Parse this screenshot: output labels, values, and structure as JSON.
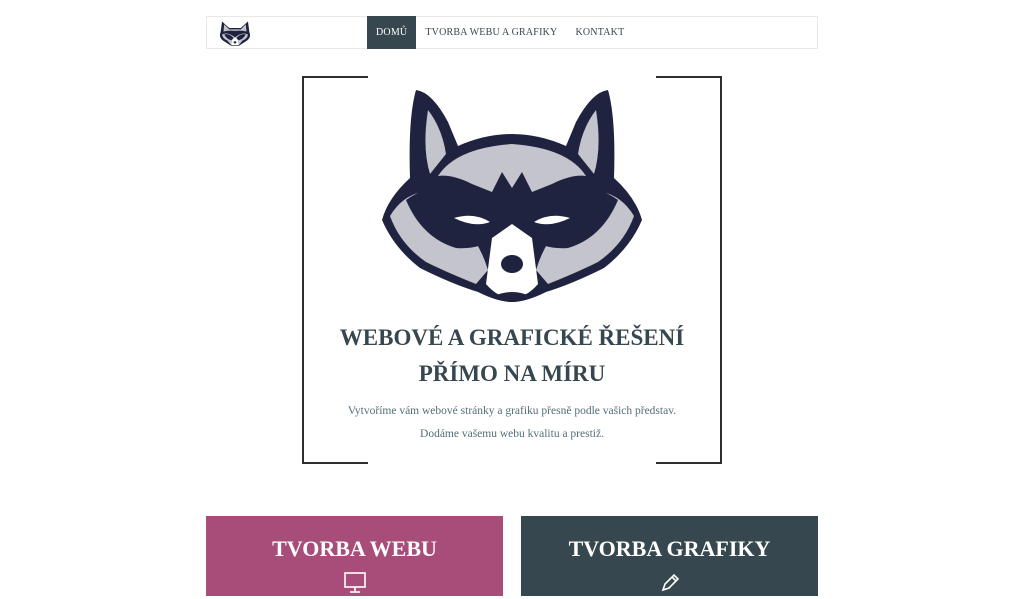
{
  "nav": {
    "logo_icon": "raccoon-logo-icon",
    "items": [
      {
        "label": "DOMŮ",
        "active": true
      },
      {
        "label": "TVORBA WEBU A GRAFIKY",
        "active": false
      },
      {
        "label": "KONTAKT",
        "active": false
      }
    ]
  },
  "hero": {
    "logo_icon": "raccoon-logo-icon",
    "title_line1": "WEBOVÉ A GRAFICKÉ ŘEŠENÍ",
    "title_line2": "PŘÍMO NA MÍRU",
    "text_line1": "Vytvoříme vám webové stránky a grafiku přesně podle vašich představ.",
    "text_line2": "Dodáme vašemu webu kvalitu a prestiž."
  },
  "cards": [
    {
      "title": "TVORBA WEBU",
      "icon": "monitor-icon",
      "color": "#a84c79"
    },
    {
      "title": "TVORBA GRAFIKY",
      "icon": "pencil-icon",
      "color": "#37474f"
    }
  ],
  "colors": {
    "primary_dark": "#37474f",
    "accent_pink": "#a84c79",
    "raccoon_navy": "#1f2340",
    "raccoon_gray": "#c3c4cc"
  }
}
